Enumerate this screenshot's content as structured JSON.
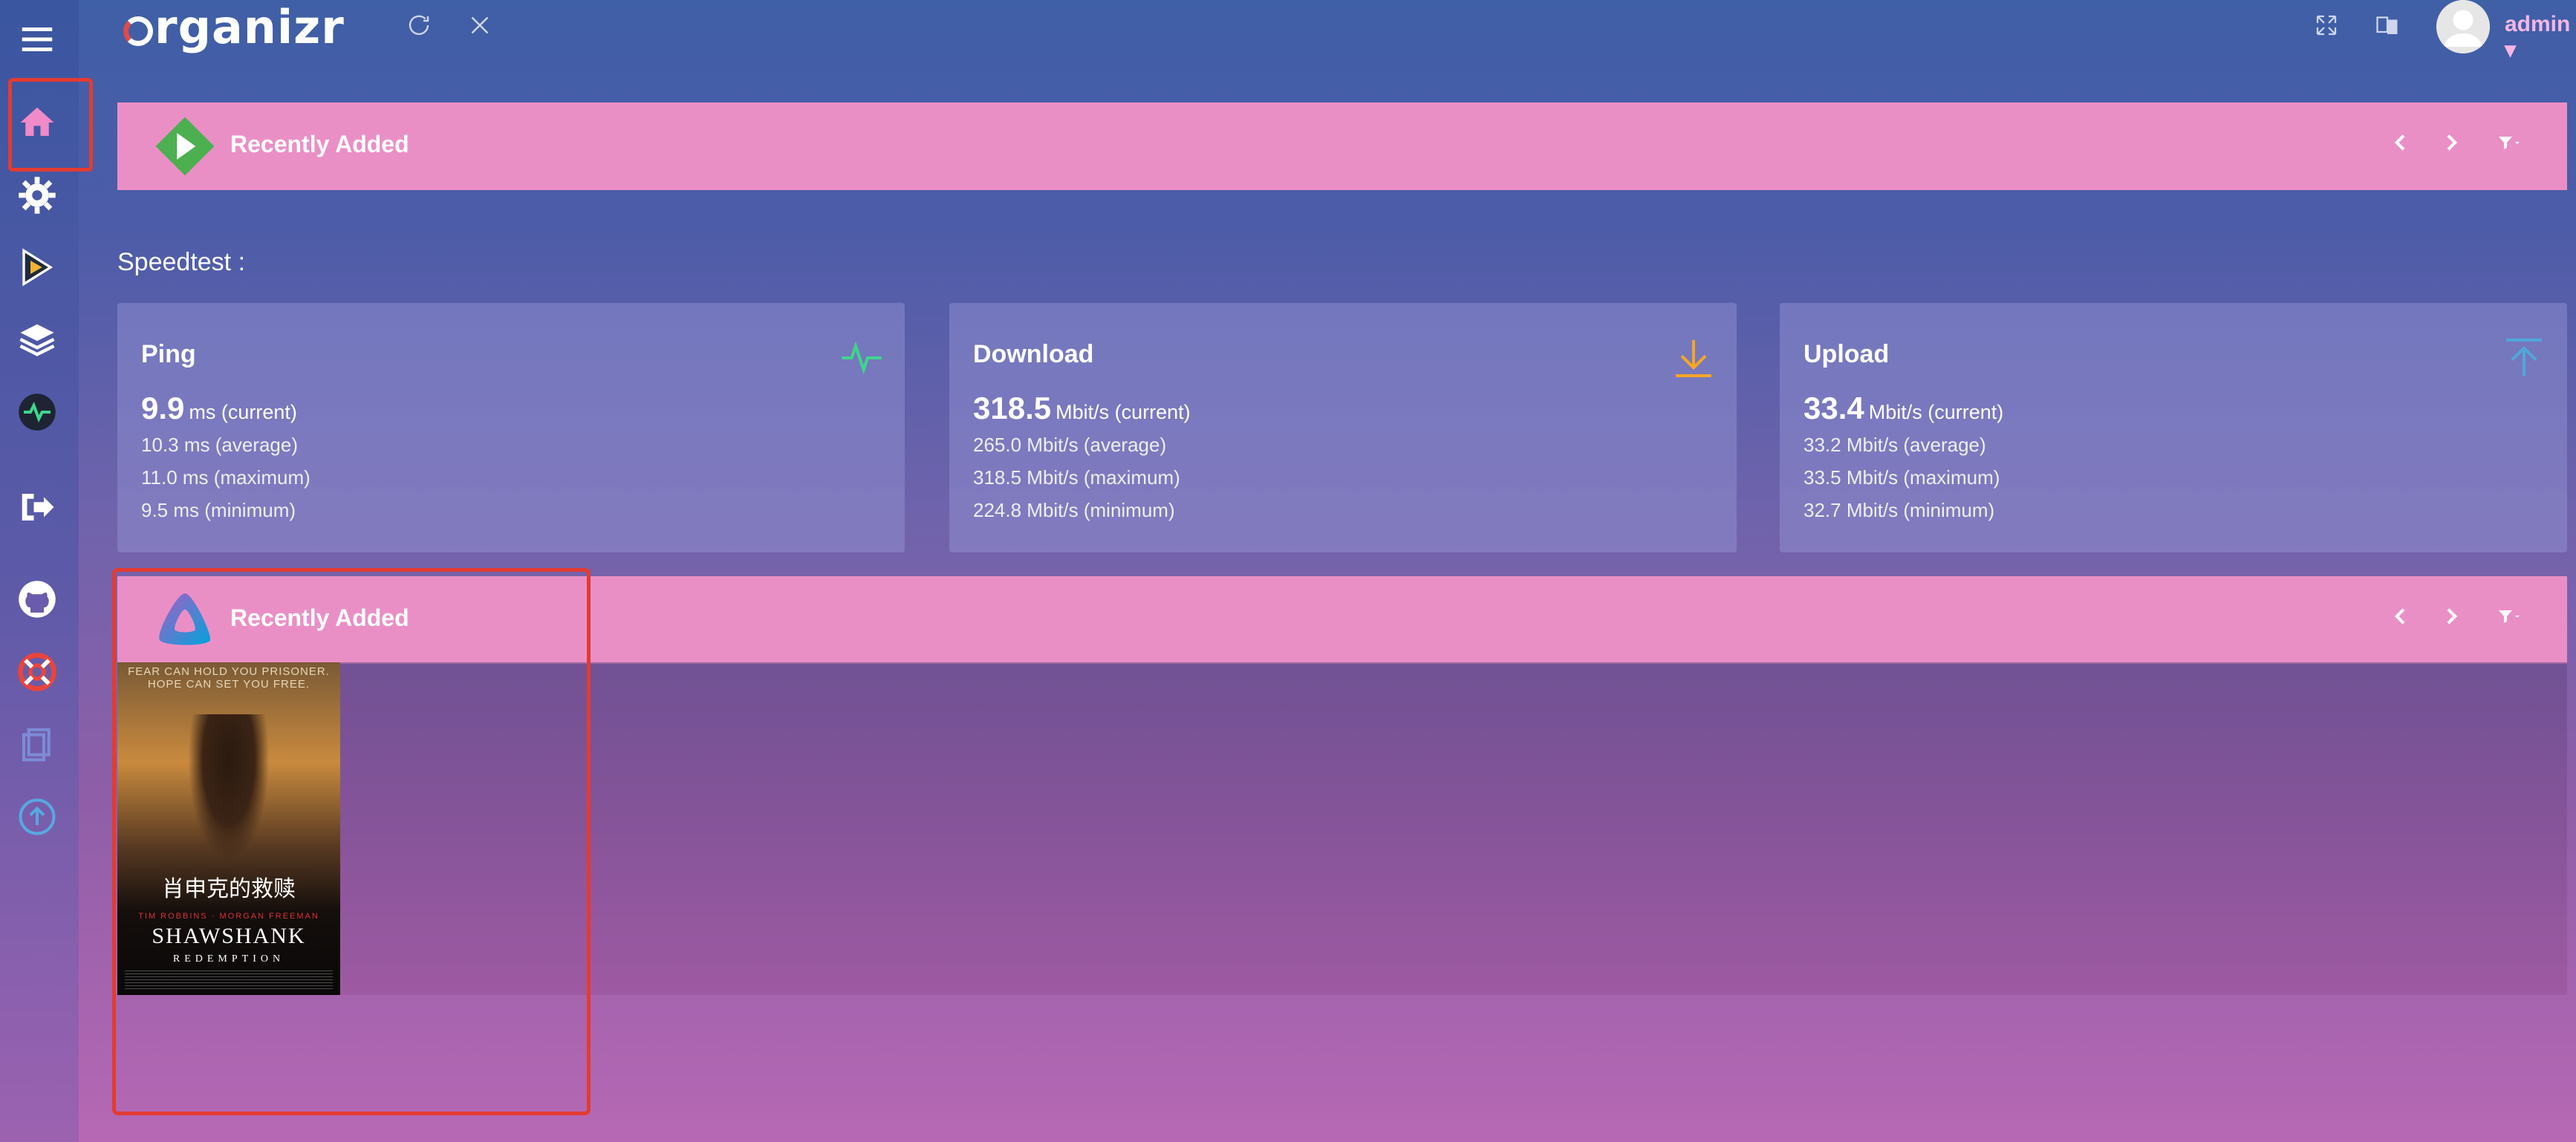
{
  "app": {
    "logo_text": "rganizr",
    "user": "admin"
  },
  "sidebar": {
    "items": [
      {
        "name": "menu-icon"
      },
      {
        "name": "home-icon"
      },
      {
        "name": "settings-icon"
      },
      {
        "name": "plex-icon"
      },
      {
        "name": "layers-icon"
      },
      {
        "name": "speedtest-icon"
      },
      {
        "name": "logout-icon"
      },
      {
        "name": "github-icon"
      },
      {
        "name": "help-icon"
      },
      {
        "name": "docs-icon"
      },
      {
        "name": "update-icon"
      }
    ]
  },
  "panels": [
    {
      "title": "Recently Added",
      "logo": "plex-logo-icon"
    },
    {
      "title": "Recently Added",
      "logo": "jellyfin-logo-icon"
    }
  ],
  "speedtest": {
    "label": "Speedtest :",
    "cards": [
      {
        "title": "Ping",
        "current": "9.9",
        "current_unit": "ms (current)",
        "average": "10.3  ms (average)",
        "maximum": "11.0  ms (maximum)",
        "minimum": "9.5  ms (minimum)"
      },
      {
        "title": "Download",
        "current": "318.5",
        "current_unit": "Mbit/s (current)",
        "average": "265.0  Mbit/s (average)",
        "maximum": "318.5  Mbit/s (maximum)",
        "minimum": "224.8  Mbit/s (minimum)"
      },
      {
        "title": "Upload",
        "current": "33.4",
        "current_unit": "Mbit/s (current)",
        "average": "33.2  Mbit/s (average)",
        "maximum": "33.5  Mbit/s (maximum)",
        "minimum": "32.7  Mbit/s (minimum)"
      }
    ]
  },
  "poster": {
    "tagline": "FEAR CAN HOLD YOU PRISONER. HOPE CAN SET YOU FREE.",
    "title_cn": "肖申克的救赎",
    "cast": "TIM ROBBINS · MORGAN FREEMAN",
    "title_en": "SHAWSHANK",
    "subtitle": "REDEMPTION"
  },
  "colors": {
    "panel_head": "#ea8fc6",
    "highlight": "#e33b31",
    "ping": "#3dd68c",
    "download": "#f5a623",
    "upload": "#4fa8d8"
  }
}
